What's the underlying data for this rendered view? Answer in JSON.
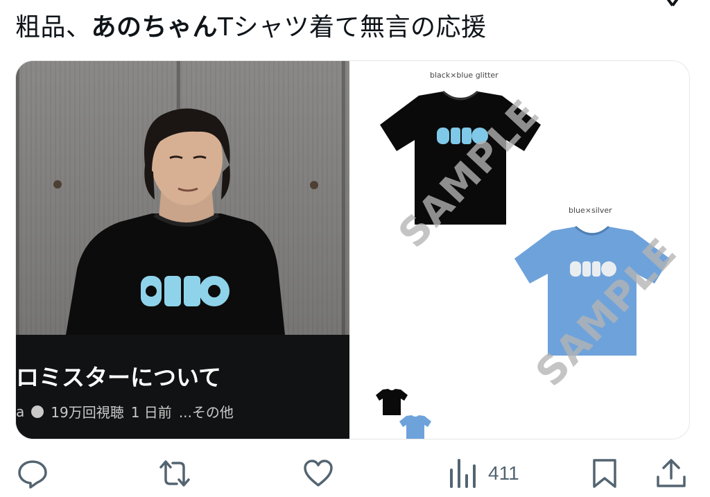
{
  "post": {
    "text_before": "粗品、",
    "text_bold": "あのちゃん",
    "text_after": "Tシャツ着て無言の応援"
  },
  "video": {
    "title": "ロミスターについて",
    "channel_fragment": "a",
    "views": "19万回視聴",
    "time_ago": "1 日前",
    "more": "...その他"
  },
  "product": {
    "label_black": "black×blue glitter",
    "label_blue": "blue×silver",
    "watermark": "SAMPLE",
    "shirt_print": "OKBO",
    "colors": {
      "black_shirt": "#0a0a0a",
      "blue_shirt": "#6ea2db",
      "glitter": "#7fc8e8"
    }
  },
  "actions": {
    "views_count": "411"
  },
  "colors": {
    "icon": "#536471",
    "text": "#0f1419",
    "video_bar": "#111213"
  }
}
